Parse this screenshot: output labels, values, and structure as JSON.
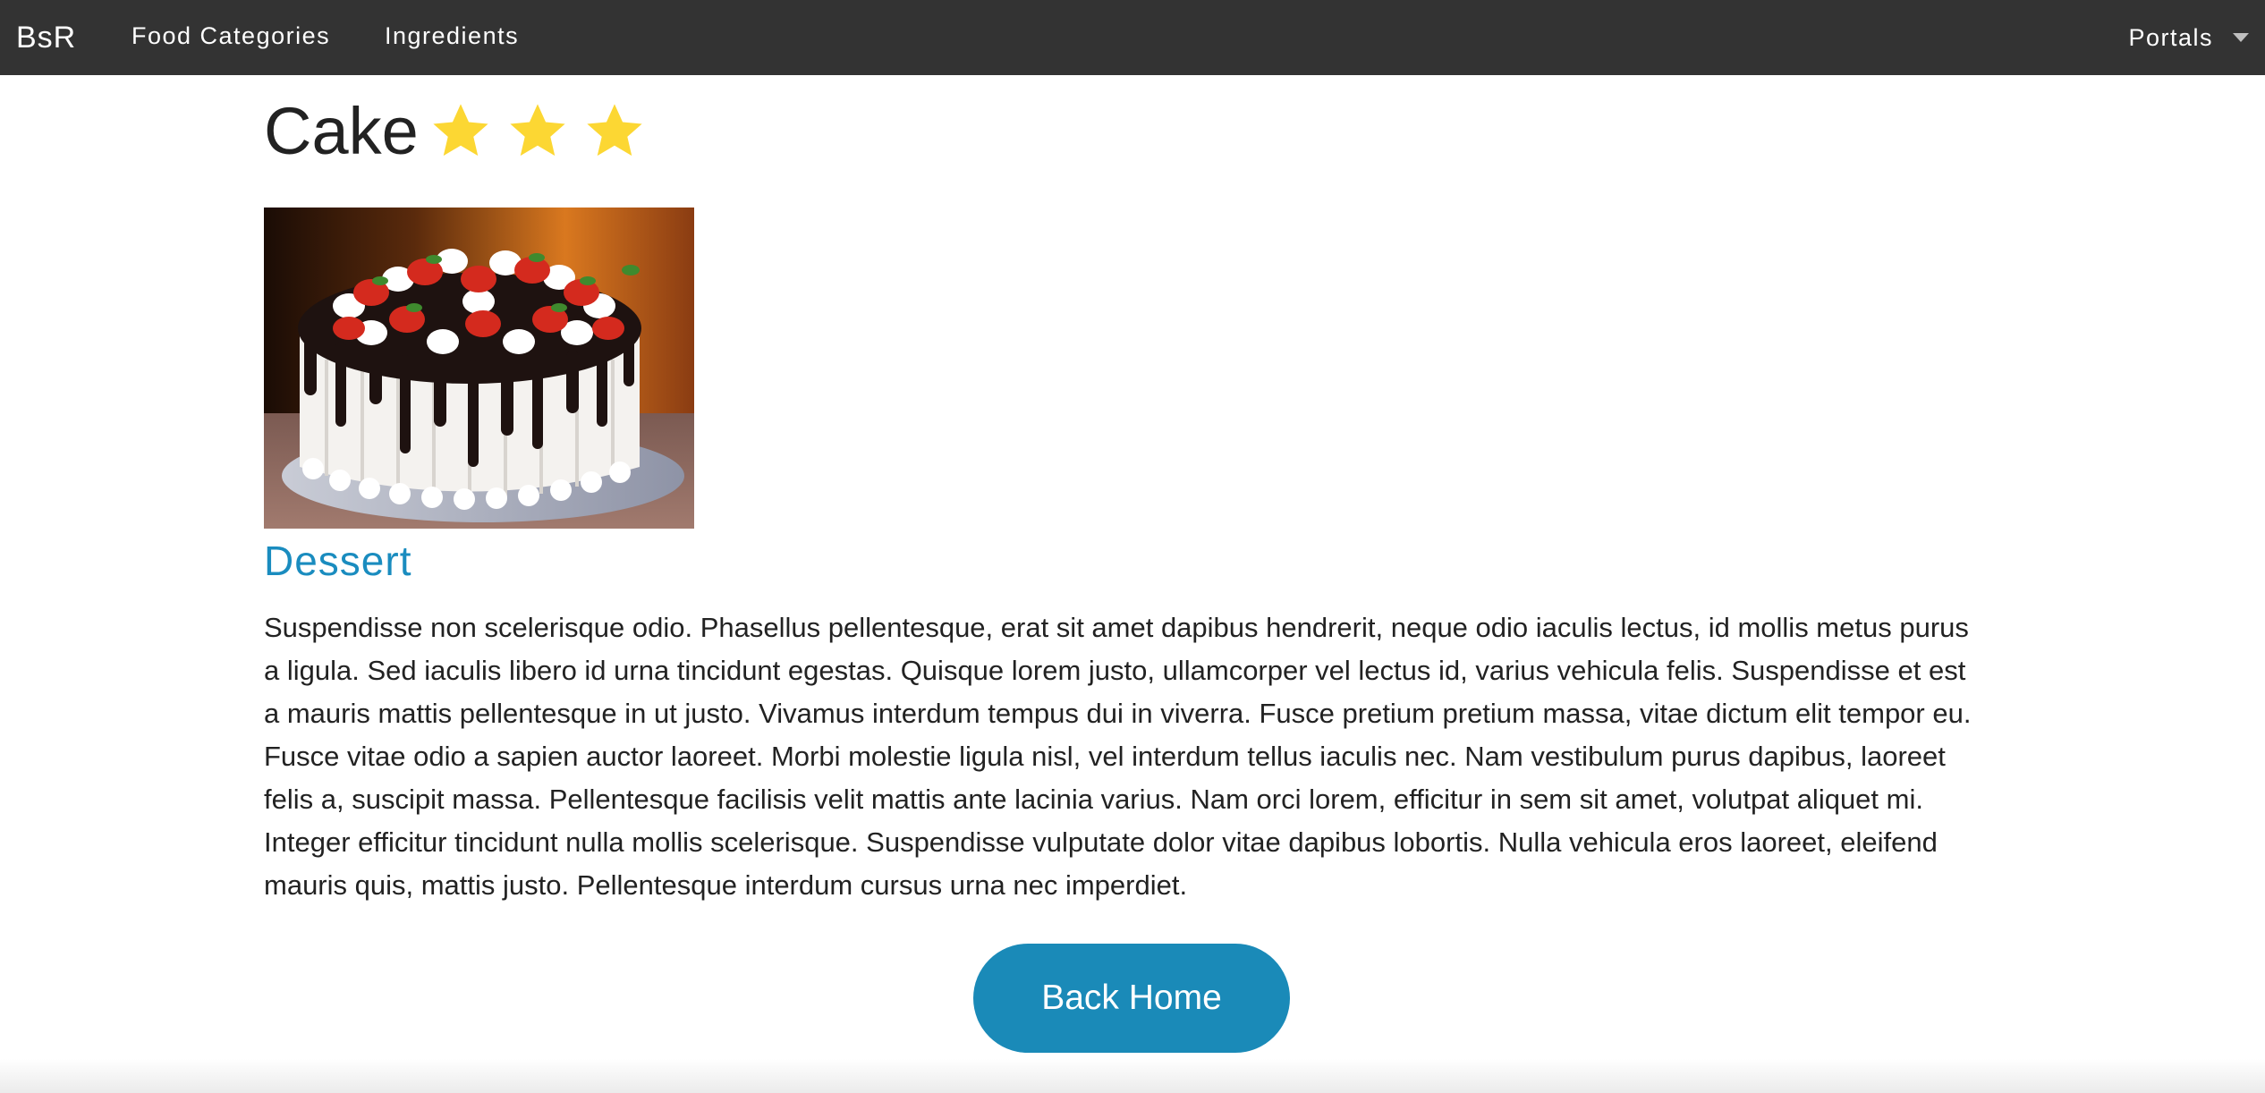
{
  "nav": {
    "brand": "BsR",
    "links": [
      {
        "label": "Food Categories"
      },
      {
        "label": "Ingredients"
      }
    ],
    "portals_label": "Portals"
  },
  "page": {
    "title": "Cake",
    "rating": 3,
    "rating_max": 3,
    "image_alt": "Cake",
    "category": "Dessert",
    "description": "Suspendisse non scelerisque odio. Phasellus pellentesque, erat sit amet dapibus hendrerit, neque odio iaculis lectus, id mollis metus purus a ligula. Sed iaculis libero id urna tincidunt egestas. Quisque lorem justo, ullamcorper vel lectus id, varius vehicula felis. Suspendisse et est a mauris mattis pellentesque in ut justo. Vivamus interdum tempus dui in viverra. Fusce pretium pretium massa, vitae dictum elit tempor eu. Fusce vitae odio a sapien auctor laoreet. Morbi molestie ligula nisl, vel interdum tellus iaculis nec. Nam vestibulum purus dapibus, laoreet felis a, suscipit massa. Pellentesque facilisis velit mattis ante lacinia varius. Nam orci lorem, efficitur in sem sit amet, volutpat aliquet mi. Integer efficitur tincidunt nulla mollis scelerisque. Suspendisse vulputate dolor vitae dapibus lobortis. Nulla vehicula eros laoreet, eleifend mauris quis, mattis justo. Pellentesque interdum cursus urna nec imperdiet.",
    "back_button": "Back Home"
  },
  "colors": {
    "navbar_bg": "#333333",
    "accent": "#1a8ab8",
    "star": "#fcd733"
  },
  "icons": {
    "rating": "star-icon",
    "dropdown": "caret-down-icon"
  }
}
